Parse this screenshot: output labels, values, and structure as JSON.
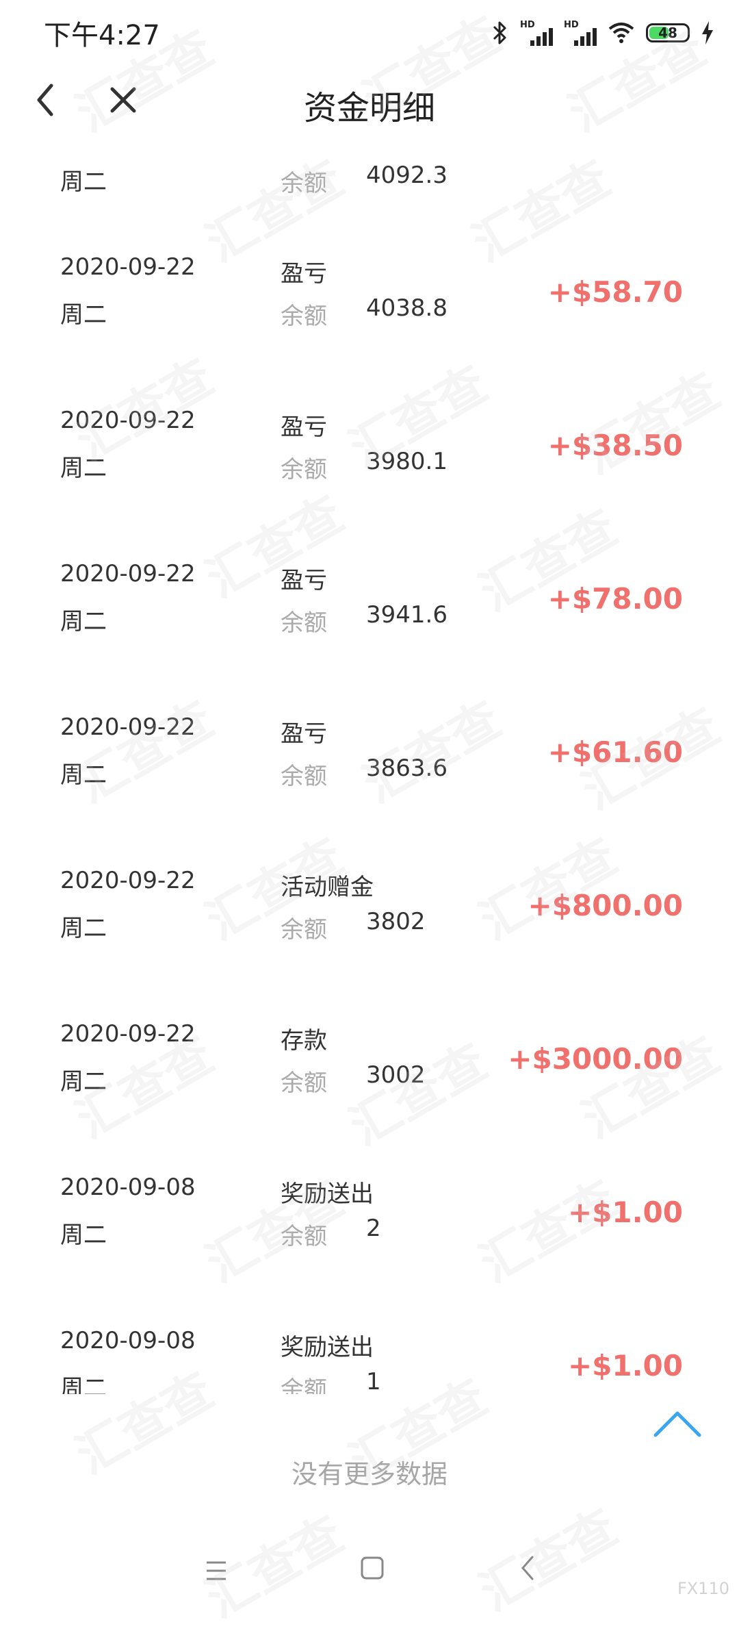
{
  "status_bar": {
    "time": "下午4:27",
    "battery": "48",
    "signal_hd_1": "HD",
    "signal_hd_2": "HD"
  },
  "header": {
    "title": "资金明细"
  },
  "list": {
    "balance_label": "余额",
    "partial_top": {
      "weekday": "周二",
      "balance": "4092.3"
    },
    "items": [
      {
        "date": "2020-09-22",
        "weekday": "周二",
        "type": "盈亏",
        "balance": "4038.8",
        "amount": "+$58.70"
      },
      {
        "date": "2020-09-22",
        "weekday": "周二",
        "type": "盈亏",
        "balance": "3980.1",
        "amount": "+$38.50"
      },
      {
        "date": "2020-09-22",
        "weekday": "周二",
        "type": "盈亏",
        "balance": "3941.6",
        "amount": "+$78.00"
      },
      {
        "date": "2020-09-22",
        "weekday": "周二",
        "type": "盈亏",
        "balance": "3863.6",
        "amount": "+$61.60"
      },
      {
        "date": "2020-09-22",
        "weekday": "周二",
        "type": "活动赠金",
        "balance": "3802",
        "amount": "+$800.00"
      },
      {
        "date": "2020-09-22",
        "weekday": "周二",
        "type": "存款",
        "balance": "3002",
        "amount": "+$3000.00"
      },
      {
        "date": "2020-09-08",
        "weekday": "周二",
        "type": "奖励送出",
        "balance": "2",
        "amount": "+$1.00"
      },
      {
        "date": "2020-09-08",
        "weekday": "周二",
        "type": "奖励送出",
        "balance": "1",
        "amount": "+$1.00"
      }
    ],
    "end_text": "没有更多数据"
  },
  "colors": {
    "amount": "#f0706e",
    "muted": "#aaaaaa",
    "accent": "#3aa6f0"
  },
  "watermark_text": "汇查查",
  "corner_mark": "FX110"
}
